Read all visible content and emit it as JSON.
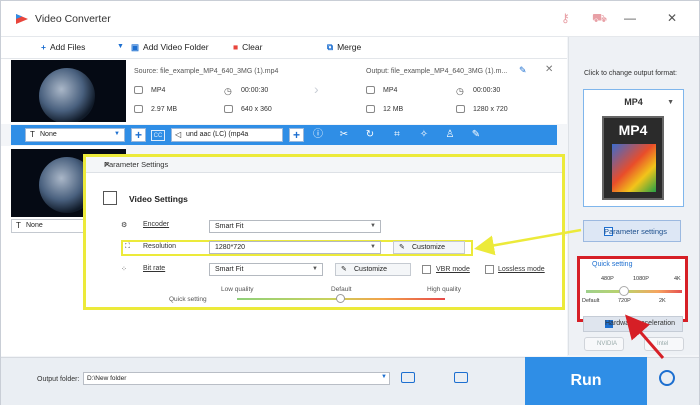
{
  "app": {
    "title": "Video Converter"
  },
  "toolbar": {
    "add_files": "Add Files",
    "add_video_folder": "Add Video Folder",
    "clear": "Clear",
    "merge": "Merge"
  },
  "file": {
    "source": "Source: file_example_MP4_640_3MG (1).mp4",
    "output": "Output: file_example_MP4_640_3MG (1).m...",
    "src_format": "MP4",
    "src_duration": "00:00:30",
    "src_size": "2.97 MB",
    "src_res": "640 x 360",
    "out_format": "MP4",
    "out_duration": "00:00:30",
    "out_size": "12 MB",
    "out_res": "1280 x 720"
  },
  "edit_bar": {
    "subtitle": "None",
    "audio": "und aac (LC) (mp4a",
    "cc": "CC"
  },
  "item2": {
    "subtitle": "None"
  },
  "right_panel": {
    "hint": "Click to change output format:",
    "format": "MP4",
    "format_icon_text": "MP4",
    "param_button": "Parameter settings",
    "quick_setting": "Quick setting",
    "qs_top": [
      "480P",
      "1080P",
      "4K"
    ],
    "qs_bottom": [
      "Default",
      "720P",
      "2K"
    ],
    "quick_value_fraction": 0.4,
    "hardware": "Hardware acceleration",
    "nvidia": "NVIDIA",
    "intel": "Intel"
  },
  "dialog": {
    "title": "Parameter Settings",
    "section": "Video Settings",
    "encoder_label": "Encoder",
    "encoder_value": "Smart Fit",
    "resolution_label": "Resolution",
    "resolution_value": "1280*720",
    "customize": "Customize",
    "bitrate_label": "Bit rate",
    "bitrate_value": "Smart Fit",
    "vbr": "VBR mode",
    "lossless": "Lossless mode",
    "quick_setting": "Quick setting",
    "low": "Low quality",
    "default": "Default",
    "high": "High quality"
  },
  "bottom": {
    "output_folder_label": "Output folder:",
    "output_folder_value": "D:\\New folder",
    "run": "Run"
  },
  "colors": {
    "accent": "#2f8ee6",
    "highlight": "#ecea3a",
    "red_box": "#d61f26"
  }
}
